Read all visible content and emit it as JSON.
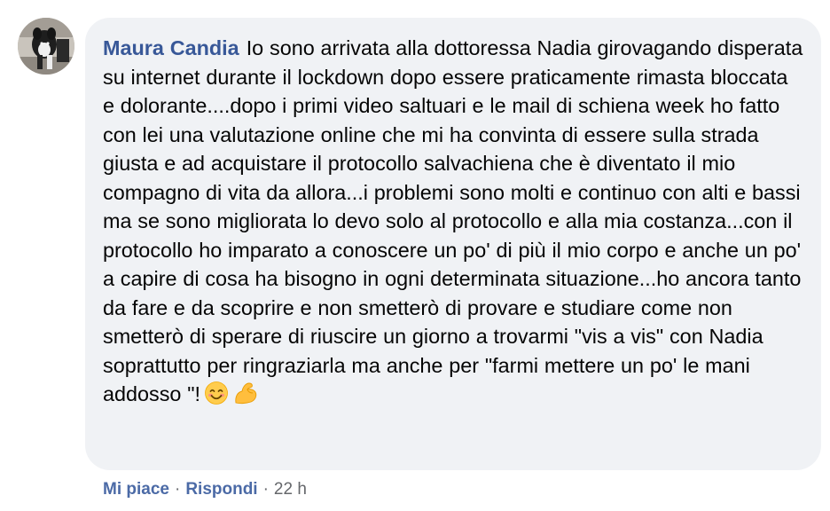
{
  "comment": {
    "author": "Maura Candia",
    "text": "Io sono arrivata alla dottoressa Nadia girovagando disperata su internet durante il lockdown dopo essere praticamente rimasta bloccata e dolorante....dopo i primi video saltuari e le mail di schiena week ho fatto con lei una valutazione online che mi ha convinta di essere sulla strada giusta e ad acquistare il protocollo salvachiena che è diventato il mio compagno di vita da allora...i problemi sono molti e continuo con alti e bassi ma se sono migliorata lo devo solo al protocollo e alla mia costanza...con il protocollo ho imparato a conoscere un po' di più il mio corpo e anche un po' a capire di cosa ha bisogno in ogni determinata situazione...ho ancora tanto da fare e da scoprire e non smetterò di provare e studiare come non smetterò di sperare di riuscire un giorno a trovarmi \"vis a vis\" con Nadia soprattutto per ringraziarla ma anche per \"farmi mettere un po' le mani addosso \"!",
    "emojis": [
      "smiling-face-with-smiling-eyes",
      "flexed-biceps"
    ]
  },
  "actions": {
    "like_label": "Mi piace",
    "separator": "·",
    "reply_label": "Rispondi",
    "timestamp": "22 h"
  },
  "colors": {
    "author": "#385898",
    "bubble_bg": "#f0f2f5",
    "meta": "#65676b"
  }
}
